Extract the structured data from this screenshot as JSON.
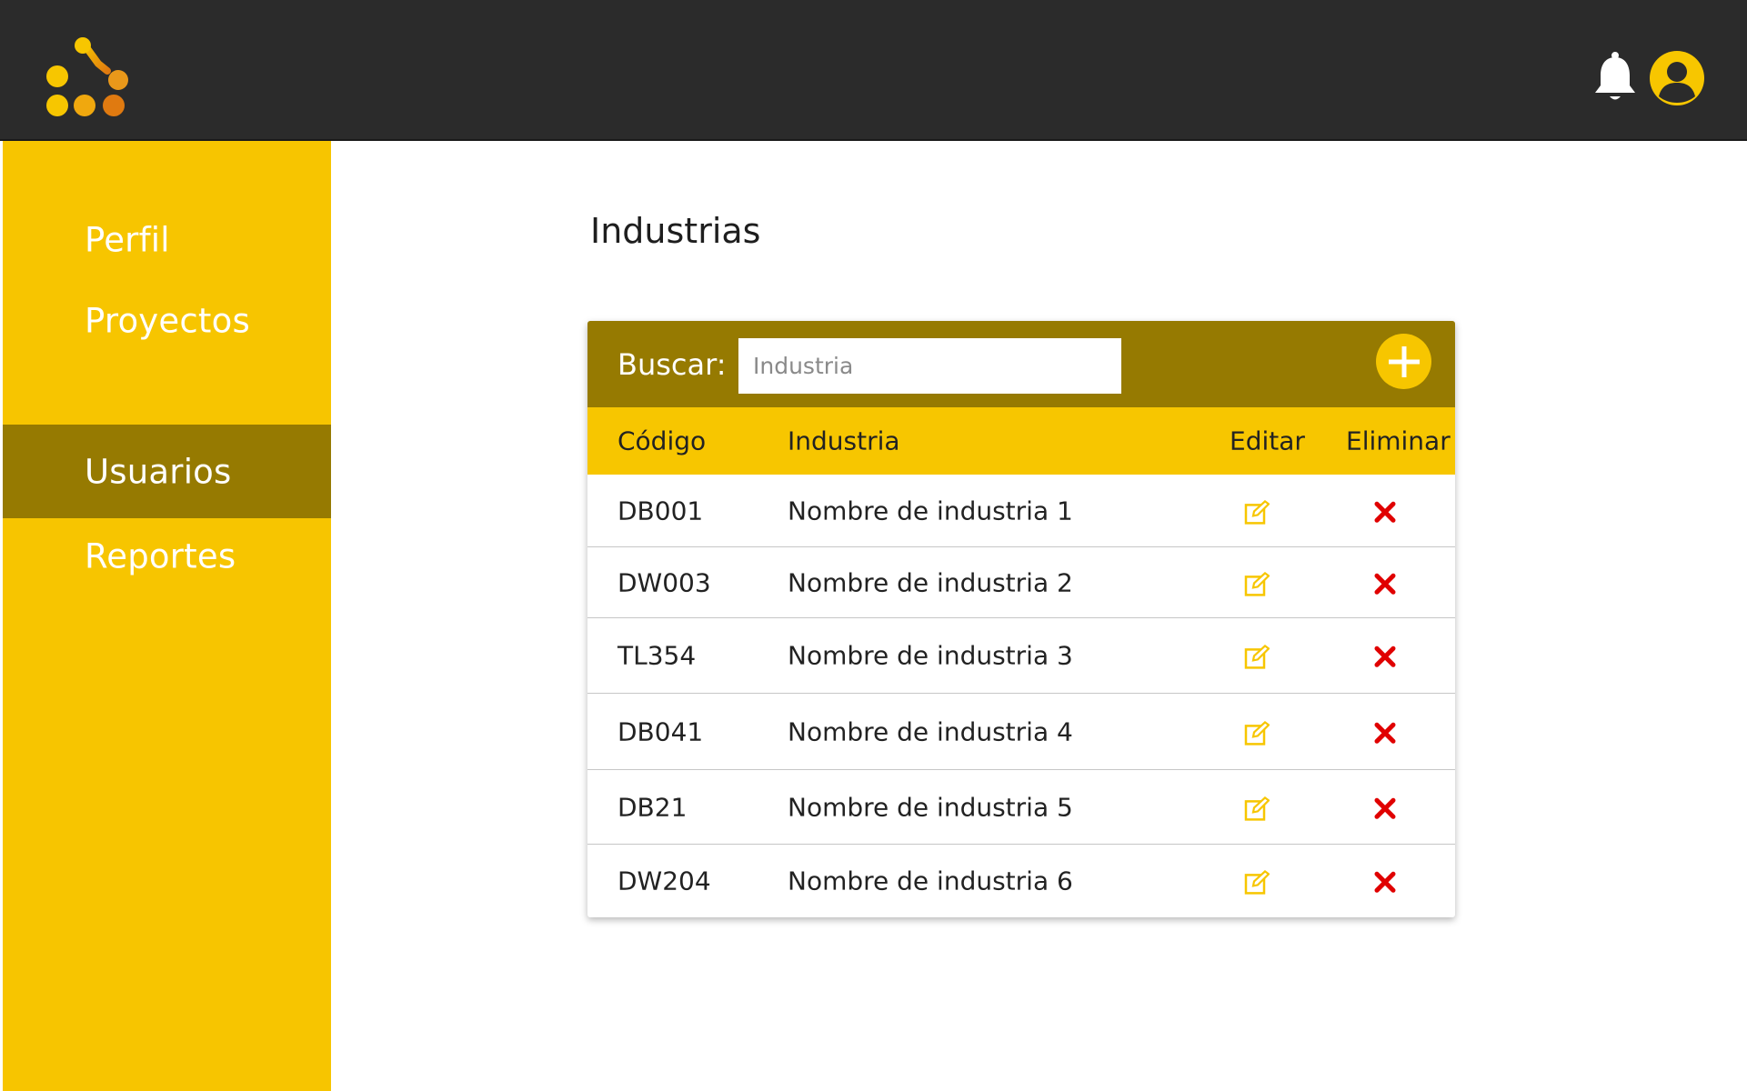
{
  "header": {
    "logo_name": "app-logo",
    "icons": [
      "bell-icon",
      "user-icon"
    ]
  },
  "sidebar": {
    "items": [
      {
        "label": "Perfil",
        "active": false
      },
      {
        "label": "Proyectos",
        "active": false
      },
      {
        "label": "Usuarios",
        "active": true
      },
      {
        "label": "Reportes",
        "active": false
      }
    ]
  },
  "main": {
    "title": "Industrias",
    "search": {
      "label": "Buscar:",
      "placeholder": "Industria",
      "value": ""
    },
    "add_button_icon": "plus-icon",
    "table": {
      "columns": [
        "Código",
        "Industria",
        "Editar",
        "Eliminar"
      ],
      "rows": [
        {
          "codigo": "DB001",
          "industria": "Nombre de industria 1"
        },
        {
          "codigo": "DW003",
          "industria": "Nombre de industria 2"
        },
        {
          "codigo": "TL354",
          "industria": "Nombre de industria 3"
        },
        {
          "codigo": "DB041",
          "industria": "Nombre de industria 4"
        },
        {
          "codigo": "DB21",
          "industria": "Nombre de industria 5"
        },
        {
          "codigo": "DW204",
          "industria": "Nombre de industria 6"
        }
      ]
    }
  },
  "colors": {
    "topbar": "#2b2b2b",
    "primary_yellow": "#f7c500",
    "dark_gold": "#967a01",
    "delete_red": "#e00000",
    "edit_yellow": "#f7c600"
  }
}
